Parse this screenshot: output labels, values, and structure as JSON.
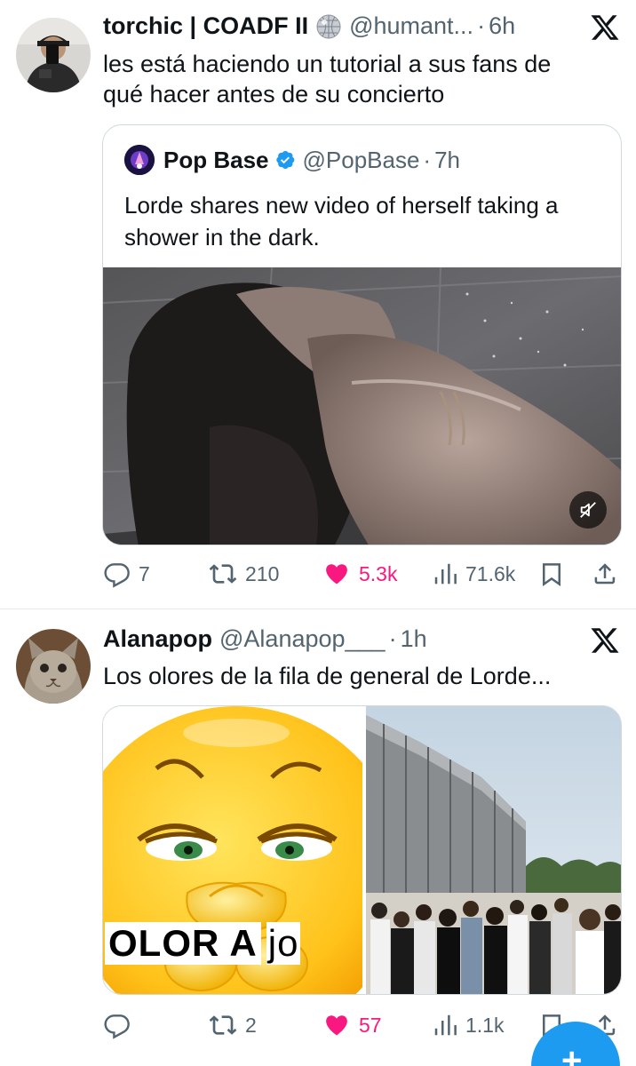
{
  "tweets": [
    {
      "display_name": "torchic | COADF II",
      "badge_icon": "disco-ball-icon",
      "handle": "@humant...",
      "dot": "·",
      "time": "6h",
      "text_lines": [
        "les está haciendo un tutorial a sus fans de",
        "qué hacer antes de su concierto"
      ],
      "quote": {
        "display_name": "Pop Base",
        "verified": true,
        "handle": "@PopBase",
        "dot": "·",
        "time": "7h",
        "text_lines": [
          "Lorde shares new video of herself taking a",
          "shower in the dark."
        ],
        "media": "video",
        "mute_icon": "mute-icon"
      },
      "actions": {
        "replies": "7",
        "reposts": "210",
        "likes": "5.3k",
        "views": "71.6k"
      }
    },
    {
      "display_name": "Alanapop",
      "handle": "@Alanapop___",
      "dot": "·",
      "time": "1h",
      "text_lines": [
        "Los olores de la fila de general de Lorde..."
      ],
      "meme_caption": {
        "part1": "OLOR A",
        "part2": "jo"
      },
      "actions": {
        "replies": "",
        "reposts": "2",
        "likes": "57",
        "views": "1.1k"
      }
    }
  ],
  "colors": {
    "like": "#f91880",
    "secondary_text": "#536471",
    "verified": "#1d9bf0",
    "fab": "#1d9bf0"
  }
}
